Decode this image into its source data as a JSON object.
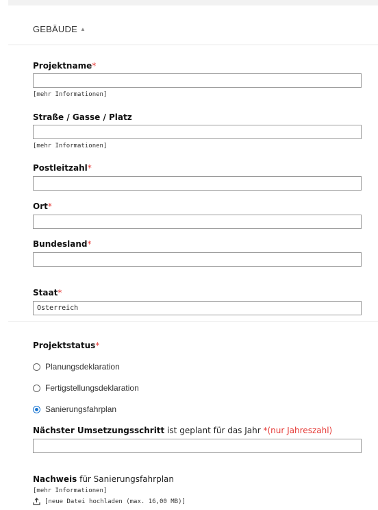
{
  "section": {
    "title": "GEBÄUDE",
    "caret": "▲"
  },
  "required_mark": "*",
  "more_info": "[mehr Informationen]",
  "fields": {
    "projektname": {
      "label": "Projektname",
      "value": ""
    },
    "strasse": {
      "label": "Straße / Gasse / Platz",
      "value": ""
    },
    "plz": {
      "label": "Postleitzahl",
      "value": ""
    },
    "ort": {
      "label": "Ort",
      "value": ""
    },
    "bundesland": {
      "label": "Bundesland",
      "value": ""
    },
    "staat": {
      "label": "Staat",
      "value": "Österreich"
    }
  },
  "projektstatus": {
    "label": "Projektstatus",
    "options": [
      {
        "label": "Planungsdeklaration",
        "checked": false
      },
      {
        "label": "Fertigstellungsdeklaration",
        "checked": false
      },
      {
        "label": "Sanierungsfahrplan",
        "checked": true
      }
    ]
  },
  "umsetzung": {
    "bold": "Nächster Umsetzungsschritt",
    "text": " ist geplant für das Jahr ",
    "required_note": "*(nur Jahreszahl)",
    "value": ""
  },
  "nachweis": {
    "bold": "Nachweis",
    "text": " für Sanierungsfahrplan",
    "more_info": "[mehr Informationen]",
    "upload_label": "[neue Datei hochladen (max. 16,00 MB)]",
    "upload_icon": "upload-icon"
  }
}
